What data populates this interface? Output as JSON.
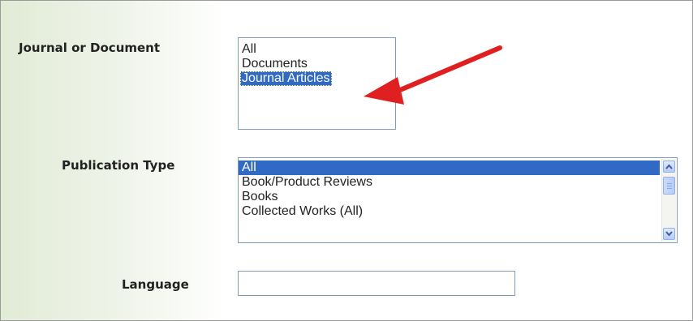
{
  "form": {
    "journal_label": "Journal or Document",
    "journal_options": [
      "All",
      "Documents",
      "Journal Articles"
    ],
    "journal_selected": "Journal Articles",
    "pubtype_label": "Publication Type",
    "pubtype_options": [
      "All",
      "Book/Product Reviews",
      "Books",
      "Collected Works (All)"
    ],
    "pubtype_selected": "All",
    "language_label": "Language",
    "language_value": ""
  },
  "colors": {
    "selection": "#316ac5",
    "arrow": "#e02020",
    "panel_gradient": "#e2ebd6"
  },
  "icons": {
    "annotation": "red-arrow-icon",
    "scroll_up": "chevron-up-icon",
    "scroll_down": "chevron-down-icon"
  }
}
